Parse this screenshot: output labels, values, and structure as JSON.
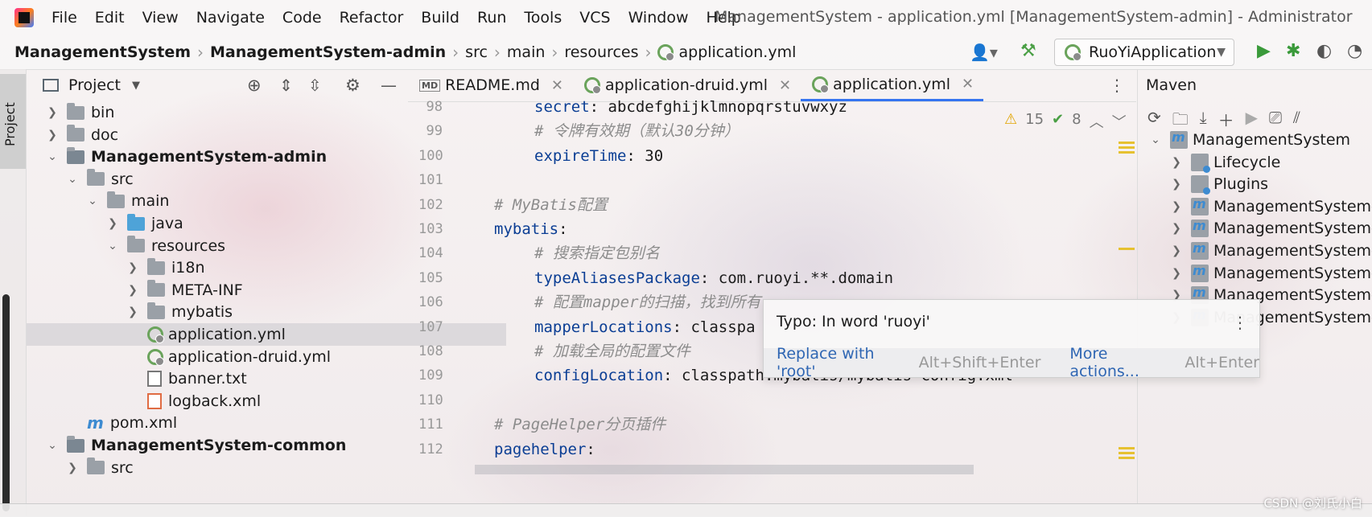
{
  "menubar": {
    "items": [
      "File",
      "Edit",
      "View",
      "Navigate",
      "Code",
      "Refactor",
      "Build",
      "Run",
      "Tools",
      "VCS",
      "Window",
      "Help"
    ],
    "title": "ManagementSystem - application.yml [ManagementSystem-admin] - Administrator"
  },
  "breadcrumb": [
    "ManagementSystem",
    "ManagementSystem-admin",
    "src",
    "main",
    "resources",
    "application.yml"
  ],
  "run_config": "RuoYiApplication",
  "left_stripe": {
    "tab": "Project"
  },
  "project": {
    "header": "Project",
    "tree": [
      {
        "label": "bin",
        "type": "folder",
        "arrow": ">"
      },
      {
        "label": "doc",
        "type": "folder",
        "arrow": ">"
      },
      {
        "label": "ManagementSystem-admin",
        "type": "module",
        "arrow": "v"
      },
      {
        "label": "src",
        "type": "folder",
        "arrow": "v"
      },
      {
        "label": "main",
        "type": "folder",
        "arrow": "v"
      },
      {
        "label": "java",
        "type": "folder-blue",
        "arrow": ">"
      },
      {
        "label": "resources",
        "type": "resources",
        "arrow": "v"
      },
      {
        "label": "i18n",
        "type": "folder",
        "arrow": ">"
      },
      {
        "label": "META-INF",
        "type": "folder",
        "arrow": ">"
      },
      {
        "label": "mybatis",
        "type": "folder",
        "arrow": ">"
      },
      {
        "label": "application.yml",
        "type": "yml",
        "arrow": ""
      },
      {
        "label": "application-druid.yml",
        "type": "yml",
        "arrow": ""
      },
      {
        "label": "banner.txt",
        "type": "txt",
        "arrow": ""
      },
      {
        "label": "logback.xml",
        "type": "xml",
        "arrow": ""
      },
      {
        "label": "pom.xml",
        "type": "maven",
        "arrow": ""
      },
      {
        "label": "ManagementSystem-common",
        "type": "module",
        "arrow": "v"
      },
      {
        "label": "src",
        "type": "folder",
        "arrow": ">"
      }
    ]
  },
  "tabs": [
    {
      "label": "README.md",
      "icon": "MD"
    },
    {
      "label": "application-druid.yml",
      "icon": "yml"
    },
    {
      "label": "application.yml",
      "icon": "yml",
      "active": true
    }
  ],
  "inspection": {
    "warnings": "15",
    "ok": "8"
  },
  "editor": {
    "lines": [
      {
        "n": "98",
        "indent": 2,
        "key": "secret",
        "val": ": abcdefghijklmnopqrstuvwxyz"
      },
      {
        "n": "99",
        "indent": 2,
        "comment": "# 令牌有效期（默认30分钟）"
      },
      {
        "n": "100",
        "indent": 2,
        "key": "expireTime",
        "val": ": 30"
      },
      {
        "n": "101",
        "indent": 0
      },
      {
        "n": "102",
        "indent": 0,
        "comment": "# MyBatis配置"
      },
      {
        "n": "103",
        "indent": 0,
        "key": "mybatis",
        "val": ":"
      },
      {
        "n": "104",
        "indent": 2,
        "comment": "# 搜索指定包别名"
      },
      {
        "n": "105",
        "indent": 2,
        "key": "typeAliasesPackage",
        "val": ": com.ruoyi.**.domain"
      },
      {
        "n": "106",
        "indent": 2,
        "comment": "# 配置mapper的扫描，找到所有"
      },
      {
        "n": "107",
        "indent": 2,
        "key": "mapperLocations",
        "val": ": classpa"
      },
      {
        "n": "108",
        "indent": 2,
        "comment": "# 加载全局的配置文件"
      },
      {
        "n": "109",
        "indent": 2,
        "key": "configLocation",
        "val": ": classpath:mybatis/mybatis-config.xml"
      },
      {
        "n": "110",
        "indent": 0
      },
      {
        "n": "111",
        "indent": 0,
        "comment": "# PageHelper分页插件"
      },
      {
        "n": "112",
        "indent": 0,
        "key": "pagehelper",
        "val": ":"
      }
    ]
  },
  "popup": {
    "message": "Typo: In word 'ruoyi'",
    "replace": "Replace with 'root'",
    "replace_key": "Alt+Shift+Enter",
    "more": "More actions...",
    "more_key": "Alt+Enter"
  },
  "maven": {
    "header": "Maven",
    "items": [
      {
        "label": "ManagementSystem",
        "icon": "module",
        "arrow": "v",
        "level": 0
      },
      {
        "label": "Lifecycle",
        "icon": "folder",
        "arrow": ">",
        "level": 1
      },
      {
        "label": "Plugins",
        "icon": "folder",
        "arrow": ">",
        "level": 1
      },
      {
        "label": "ManagementSystem-ac",
        "icon": "module",
        "arrow": ">",
        "level": 1
      },
      {
        "label": "ManagementSystem-co",
        "icon": "module",
        "arrow": ">",
        "level": 1
      },
      {
        "label": "ManagementSystem-fr",
        "icon": "module",
        "arrow": ">",
        "level": 1
      },
      {
        "label": "ManagementSystem-ge",
        "icon": "module",
        "arrow": ">",
        "level": 1
      },
      {
        "label": "ManagementSystem-qu",
        "icon": "module",
        "arrow": ">",
        "level": 1
      },
      {
        "label": "ManagementSystem-sy",
        "icon": "module",
        "arrow": ">",
        "level": 1
      }
    ]
  },
  "watermark": "CSDN @刘氏小白"
}
